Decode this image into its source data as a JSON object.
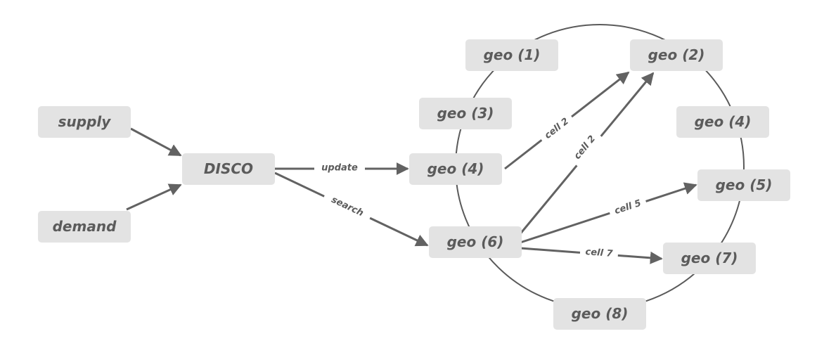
{
  "diagram": {
    "colors": {
      "node_fill": "#e3e3e3",
      "node_text": "#5b5b5b",
      "edge": "#626262",
      "background": "#ffffff"
    },
    "nodes": [
      {
        "id": "supply",
        "label": "supply"
      },
      {
        "id": "demand",
        "label": "demand"
      },
      {
        "id": "disco",
        "label": "DISCO"
      },
      {
        "id": "geo1",
        "label": "geo (1)"
      },
      {
        "id": "geo2",
        "label": "geo (2)"
      },
      {
        "id": "geo3",
        "label": "geo (3)"
      },
      {
        "id": "geo4r",
        "label": "geo (4)"
      },
      {
        "id": "geo4",
        "label": "geo (4)"
      },
      {
        "id": "geo5",
        "label": "geo (5)"
      },
      {
        "id": "geo6",
        "label": "geo (6)"
      },
      {
        "id": "geo7",
        "label": "geo (7)"
      },
      {
        "id": "geo8",
        "label": "geo (8)"
      }
    ],
    "edges": [
      {
        "from": "supply",
        "to": "disco",
        "label": ""
      },
      {
        "from": "demand",
        "to": "disco",
        "label": ""
      },
      {
        "from": "disco",
        "to": "geo4",
        "label": "update"
      },
      {
        "from": "disco",
        "to": "geo6",
        "label": "search"
      },
      {
        "from": "geo4",
        "to": "geo2",
        "label": "cell 2"
      },
      {
        "from": "geo6",
        "to": "geo2",
        "label": "cell 2"
      },
      {
        "from": "geo6",
        "to": "geo5",
        "label": "cell 5"
      },
      {
        "from": "geo6",
        "to": "geo7",
        "label": "cell 7"
      }
    ],
    "ring": {
      "description": "geo nodes arranged on a ring",
      "members": [
        "geo1",
        "geo2",
        "geo4r",
        "geo5",
        "geo7",
        "geo8",
        "geo6",
        "geo4",
        "geo3"
      ]
    }
  }
}
